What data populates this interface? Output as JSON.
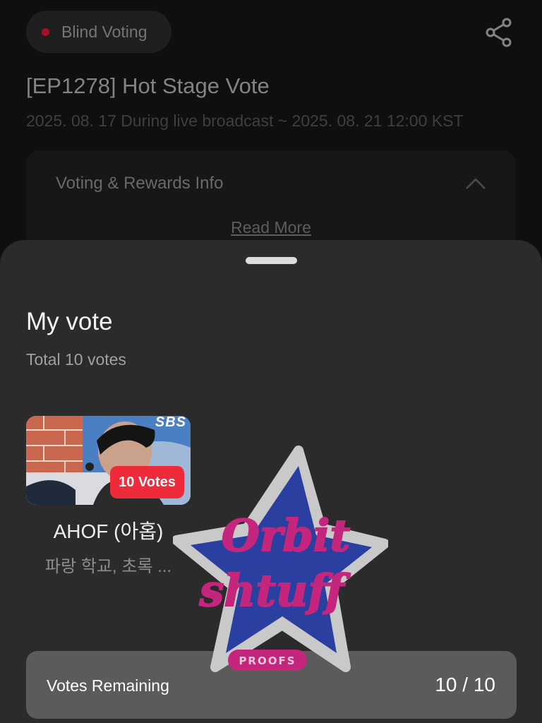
{
  "header": {
    "badge_label": "Blind Voting",
    "share_icon": "share-icon"
  },
  "event": {
    "title": "[EP1278] Hot Stage Vote",
    "period": "2025. 08. 17 During live broadcast ~ 2025. 08. 21 12:00 KST"
  },
  "info": {
    "title": "Voting & Rewards Info",
    "read_more": "Read More"
  },
  "sheet": {
    "title": "My vote",
    "subtitle": "Total 10 votes",
    "votes": [
      {
        "artist": "AHOF (아홉)",
        "song": "파랑 학교, 초록 ...",
        "votes_label": "10 Votes",
        "thumb_logo": "SBS"
      }
    ],
    "remaining_label": "Votes Remaining",
    "remaining_count": "10 / 10"
  },
  "watermark": {
    "line1": "Orbit",
    "line2": "shtuff",
    "ribbon": "PROOFS"
  },
  "colors": {
    "accent_red": "#ee2b3a",
    "sheet_bg": "#2b2b2b",
    "watermark_pink": "#c4267d",
    "watermark_blue": "#2b3fa0"
  }
}
